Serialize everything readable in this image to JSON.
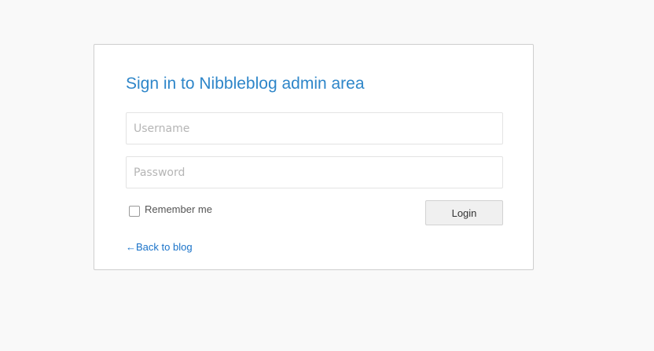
{
  "login": {
    "title": "Sign in to Nibbleblog admin area",
    "username": {
      "placeholder": "Username",
      "value": ""
    },
    "password": {
      "placeholder": "Password",
      "value": ""
    },
    "remember_label": "Remember me",
    "remember_checked": false,
    "login_button_label": "Login",
    "back_link_label": "←Back to blog"
  },
  "colors": {
    "title": "#2e86c9",
    "link": "#1a73c9",
    "page_background": "#f9f9f9"
  }
}
